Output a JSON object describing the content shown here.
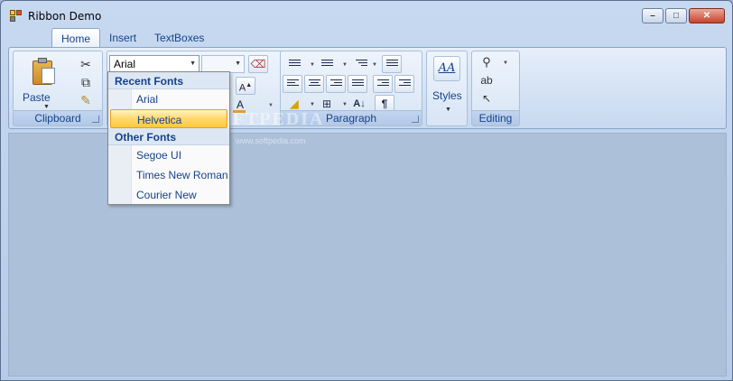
{
  "window": {
    "title": "Ribbon Demo",
    "controls": {
      "minimize": "–",
      "maximize": "□",
      "close": "✕"
    }
  },
  "tabs": [
    {
      "label": "Home",
      "active": true
    },
    {
      "label": "Insert",
      "active": false
    },
    {
      "label": "TextBoxes",
      "active": false
    }
  ],
  "ribbon": {
    "clipboard": {
      "label": "Clipboard",
      "paste_label": "Paste",
      "icons": [
        "paste-icon",
        "cut-icon",
        "copy-icon",
        "format-painter-icon"
      ]
    },
    "font": {
      "font_name": "Arial",
      "font_size": "",
      "grow_font_label": "A",
      "font_color_label": "A",
      "font_color": "#e89a2c"
    },
    "paragraph": {
      "label": "Paragraph",
      "icons": [
        "bullets-icon",
        "numbering-icon",
        "multilevel-list-icon",
        "line-spacing-icon",
        "align-left-icon",
        "align-center-icon",
        "align-right-icon",
        "justify-icon",
        "decrease-indent-icon",
        "increase-indent-icon",
        "shading-icon",
        "borders-icon",
        "sort-icon",
        "show-formatting-icon"
      ]
    },
    "styles": {
      "label": "Styles",
      "icon_text": "AA"
    },
    "editing": {
      "label": "Editing",
      "icons": [
        "find-icon",
        "replace-icon",
        "select-icon"
      ]
    }
  },
  "font_dropdown": {
    "sections": [
      {
        "header": "Recent Fonts",
        "items": [
          "Arial",
          "Helvetica"
        ]
      },
      {
        "header": "Other Fonts",
        "items": [
          "Segoe UI",
          "Times New Roman",
          "Courier New"
        ]
      }
    ],
    "highlighted": "Helvetica"
  },
  "watermark": {
    "text": "SOFTPEDIA",
    "url": "www.softpedia.com"
  },
  "colors": {
    "accent": "#15428b",
    "highlight": "#ffd86b",
    "client_background": "#adc0da"
  }
}
